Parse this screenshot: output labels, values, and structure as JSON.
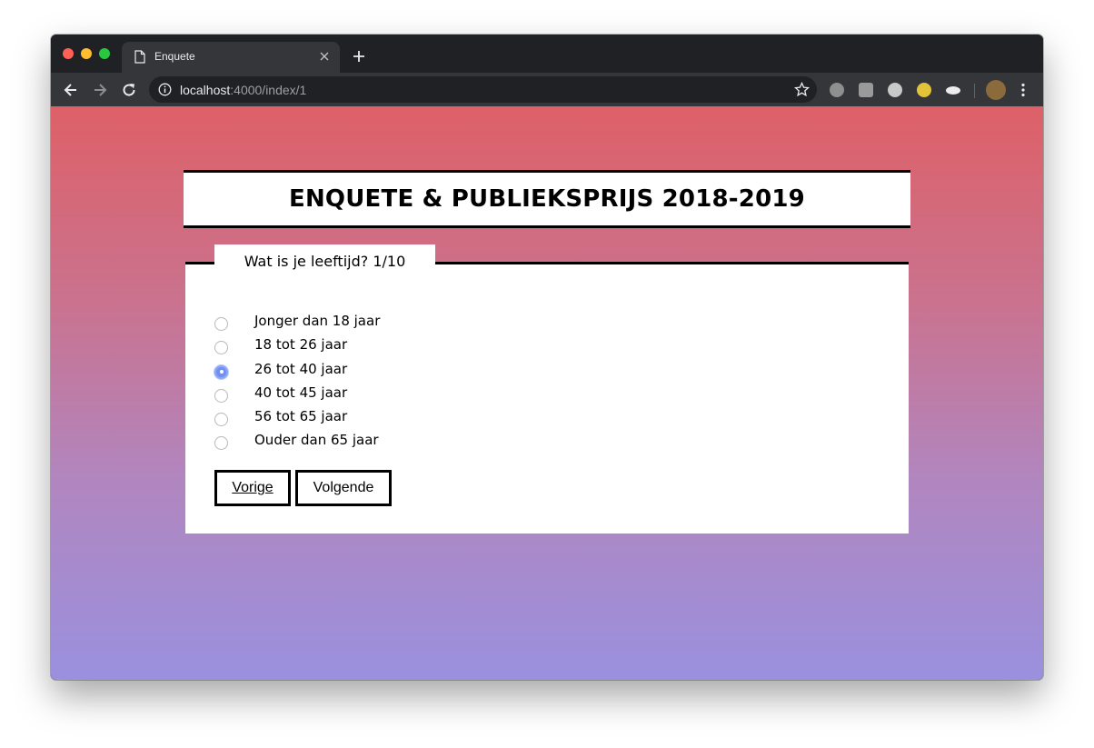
{
  "browser": {
    "tab_title": "Enquete",
    "url_host": "localhost",
    "url_rest": ":4000/index/1"
  },
  "page": {
    "title": "ENQUETE & PUBLIEKSPRIJS 2018-2019",
    "question": "Wat is je leeftijd?",
    "progress": "1/10",
    "options": [
      {
        "label": "Jonger dan 18 jaar",
        "selected": false
      },
      {
        "label": "18 tot 26 jaar",
        "selected": false
      },
      {
        "label": "26 tot 40 jaar",
        "selected": true
      },
      {
        "label": "40 tot 45 jaar",
        "selected": false
      },
      {
        "label": "56 tot 65 jaar",
        "selected": false
      },
      {
        "label": "Ouder dan 65 jaar",
        "selected": false
      }
    ],
    "prev_label": "Vorige",
    "next_label": "Volgende"
  },
  "colors": {
    "gradient_top": "#de6067",
    "gradient_bottom": "#9a90de",
    "radio_selected": "#6f8ff2"
  },
  "icons": {
    "tab": "document-icon",
    "close": "close-icon",
    "new_tab": "plus-icon",
    "back": "arrow-left-icon",
    "forward": "arrow-right-icon",
    "reload": "reload-icon",
    "info": "info-icon",
    "bookmark": "star-icon",
    "menu": "kebab-menu-icon"
  }
}
